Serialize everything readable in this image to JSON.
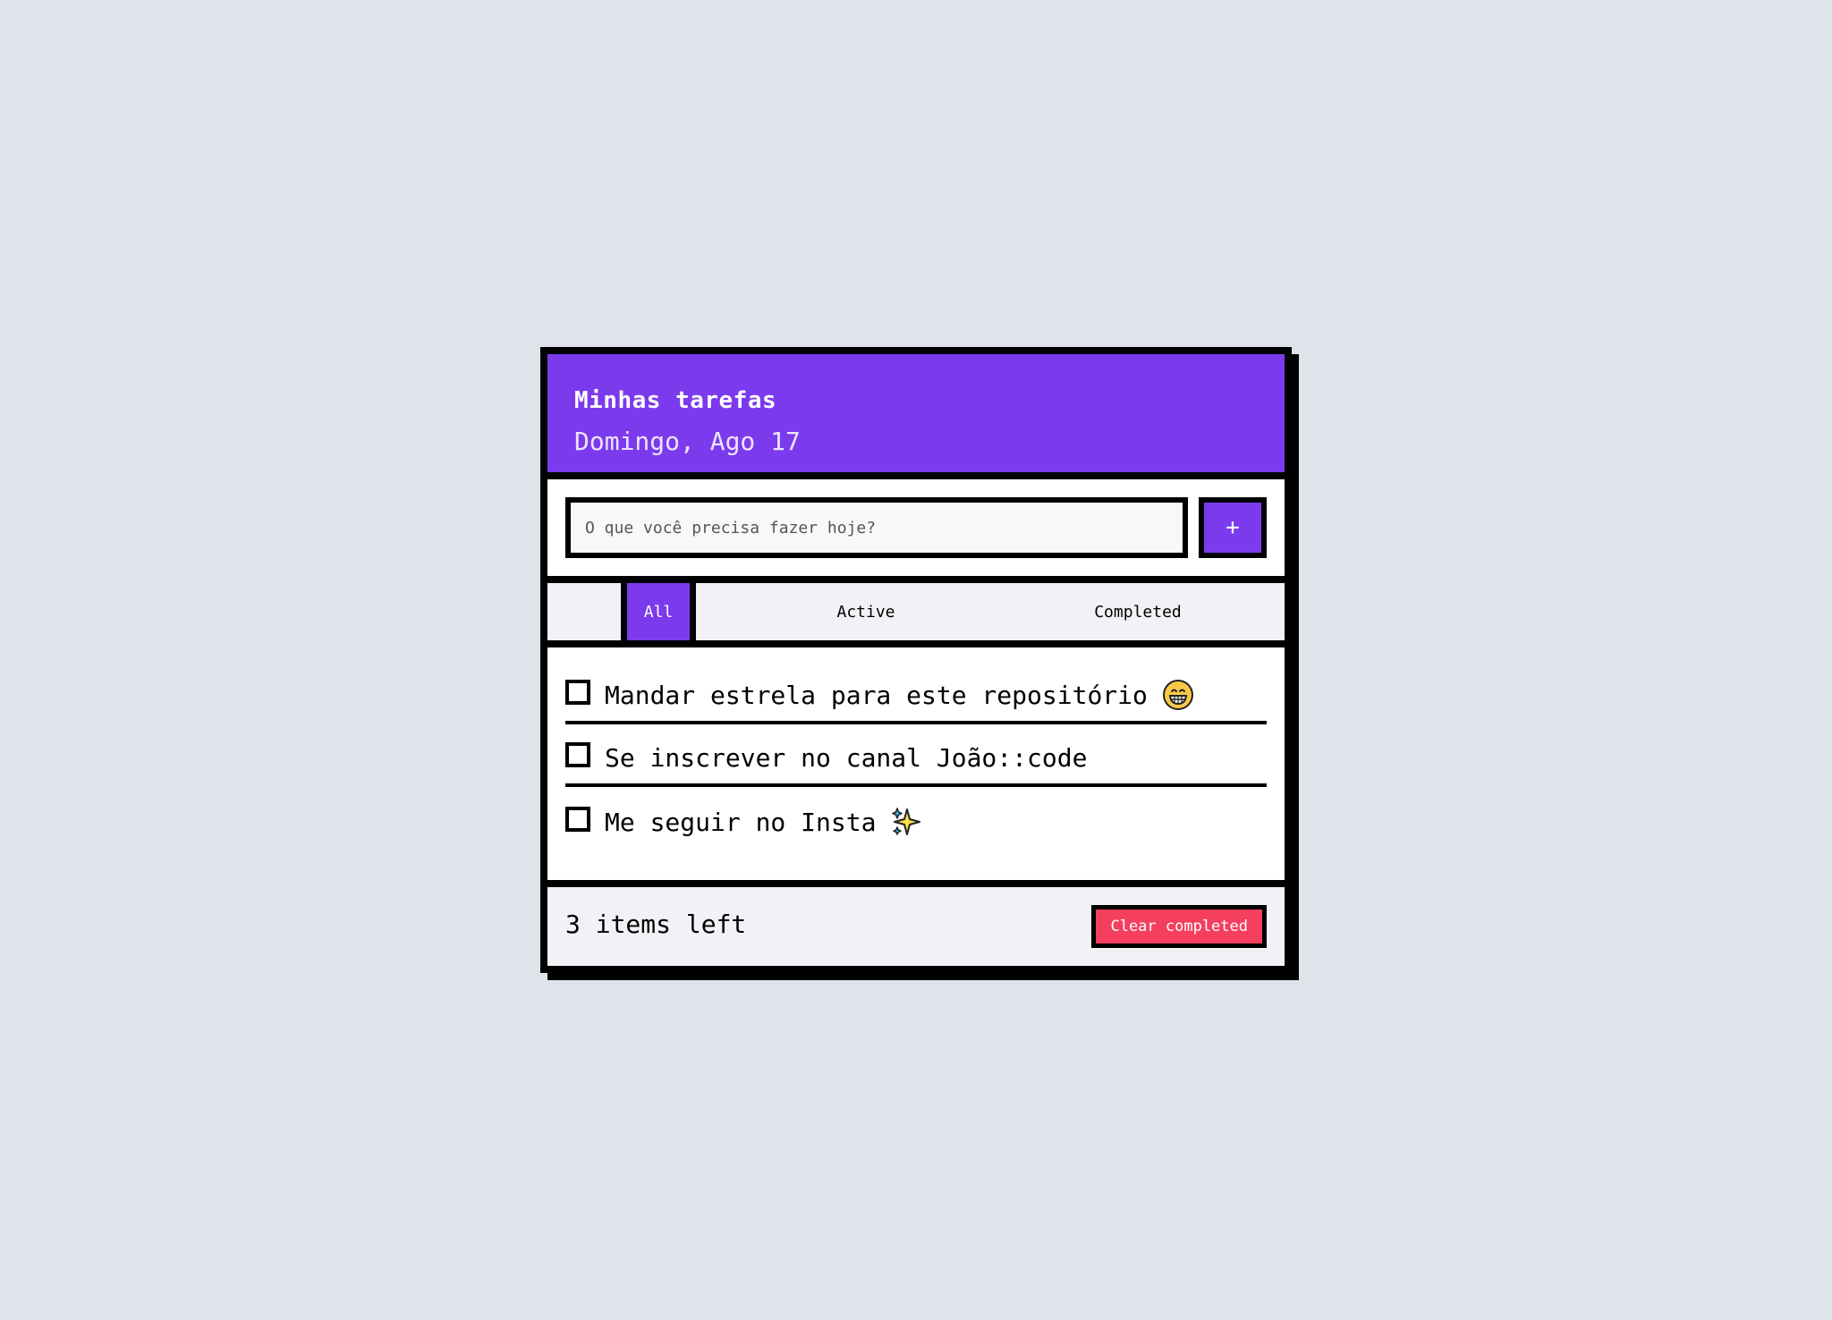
{
  "header": {
    "title": "Minhas tarefas",
    "date": "Domingo, Ago 17"
  },
  "new_task": {
    "placeholder": "O que você precisa fazer hoje?",
    "value": "",
    "add_label": "+"
  },
  "filters": {
    "all": "All",
    "active": "Active",
    "completed": "Completed",
    "selected": "All"
  },
  "tasks": [
    {
      "text": "Mandar estrela para este repositório",
      "completed": false,
      "emoji": "grinning-face-icon"
    },
    {
      "text": "Se inscrever no canal João::code",
      "completed": false,
      "emoji": ""
    },
    {
      "text": "Me seguir no Insta",
      "completed": false,
      "emoji": "sparkles-icon"
    }
  ],
  "footer": {
    "items_left": "3 items left",
    "clear_label": "Clear completed"
  },
  "colors": {
    "accent": "#7c3aed",
    "danger": "#f43f5e",
    "background": "#dfe3ea",
    "border": "#000000"
  }
}
